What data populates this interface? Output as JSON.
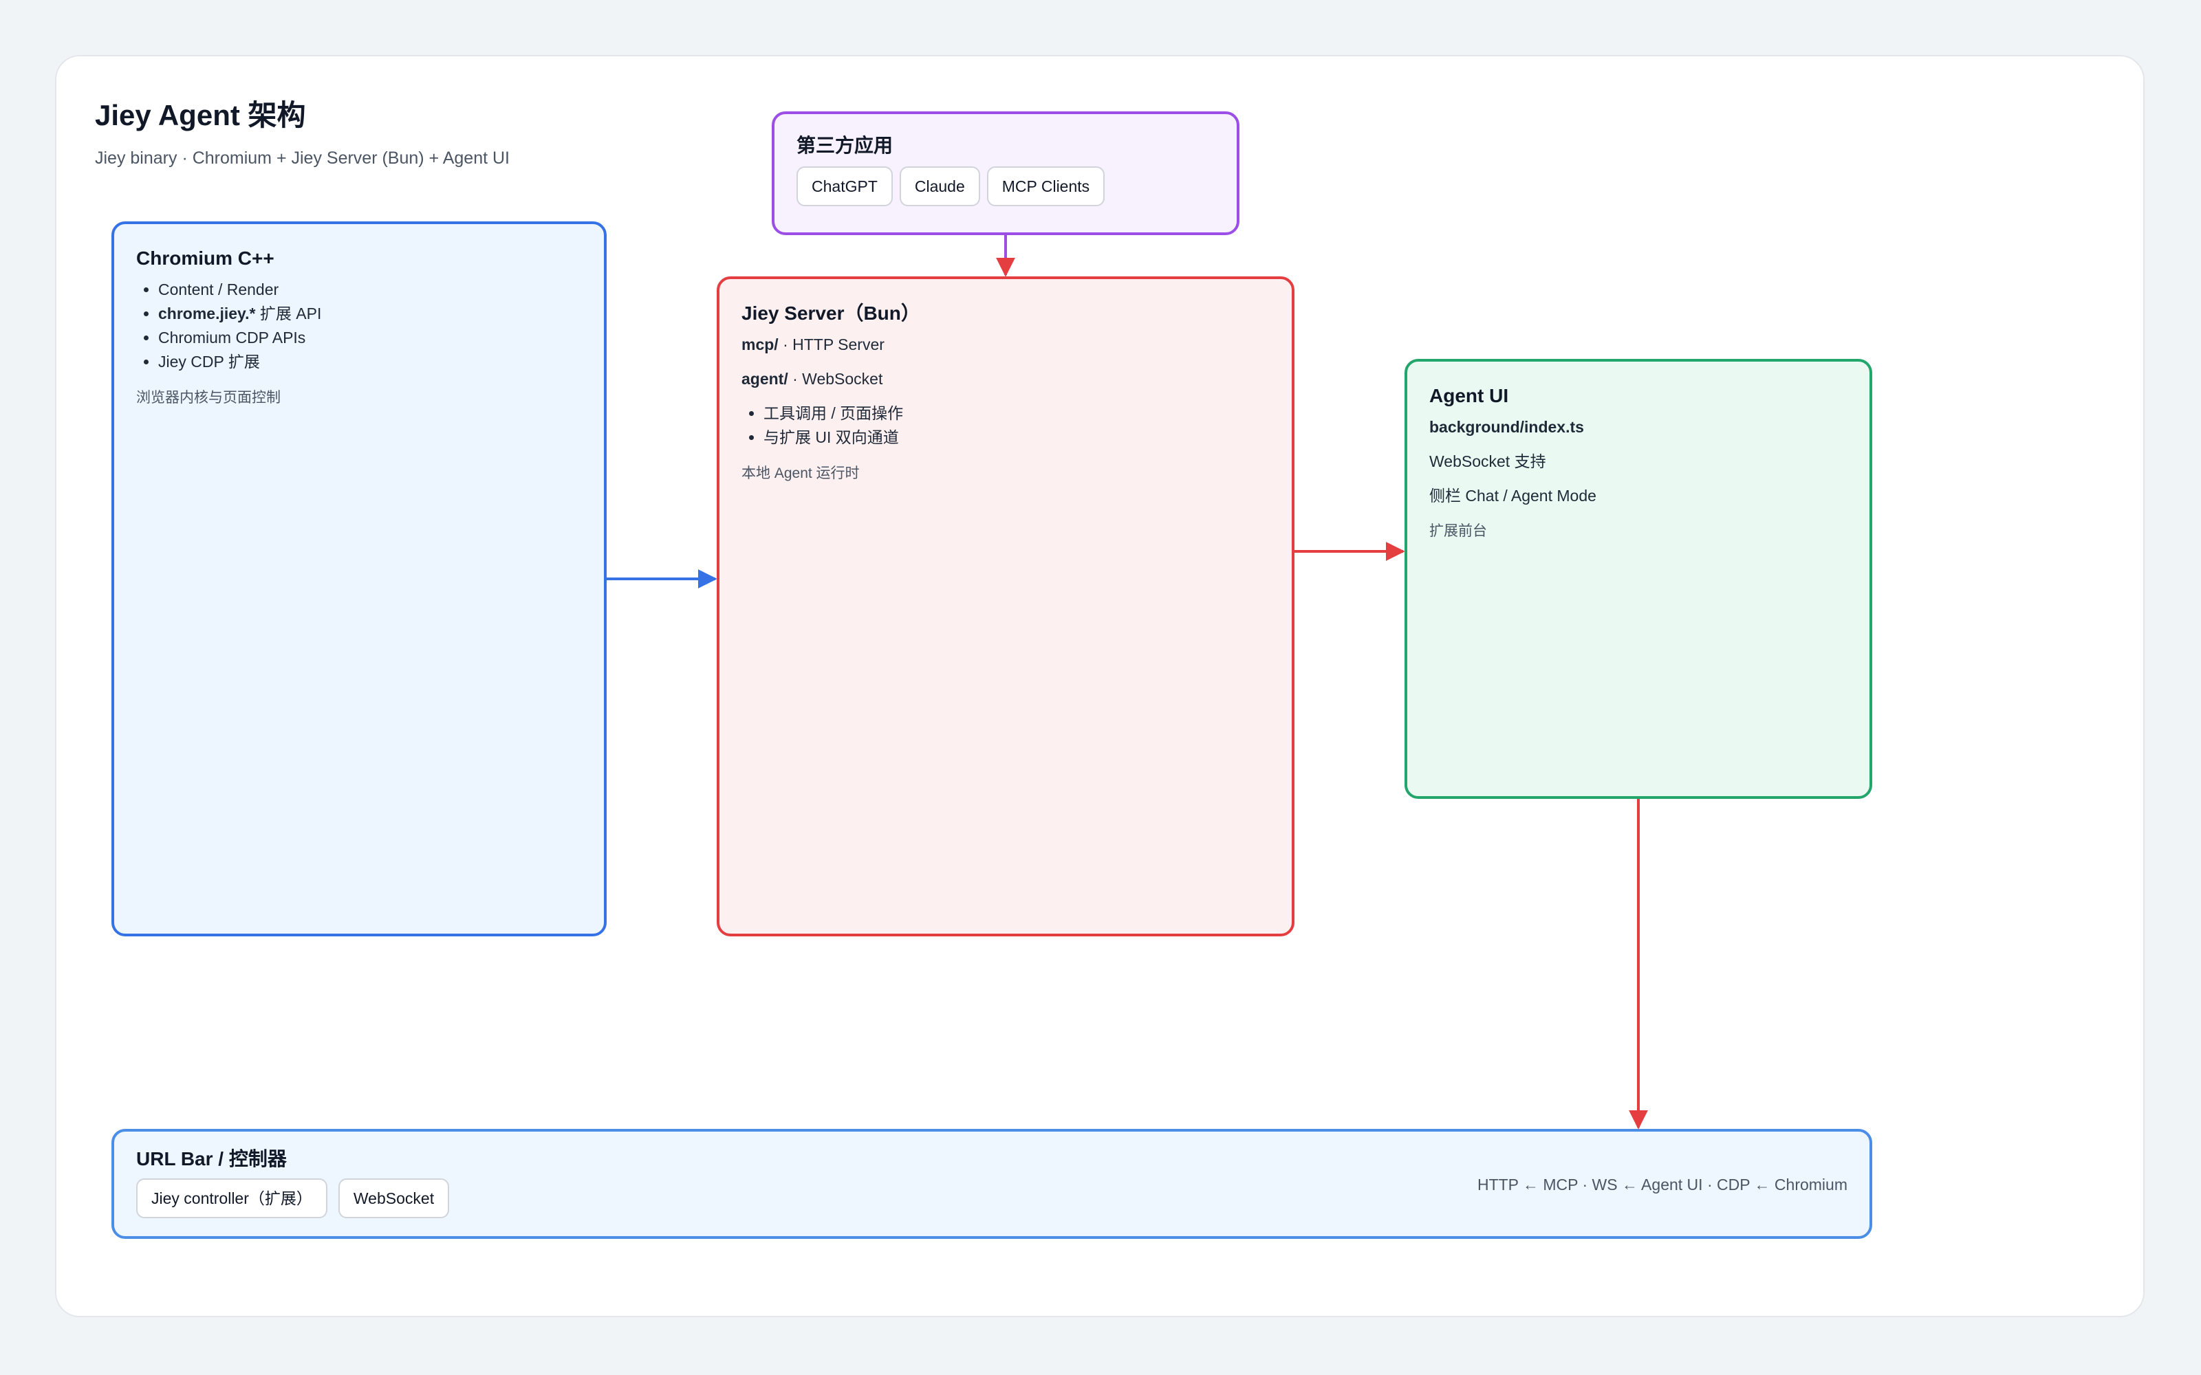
{
  "header": {
    "title": "Jiey Agent 架构",
    "subtitle": "Jiey binary · Chromium + Jiey Server (Bun) + Agent UI"
  },
  "chromium": {
    "title": "Chromium C++",
    "items": [
      {
        "bold": "",
        "text": "Content / Render"
      },
      {
        "bold": "chrome.jiey.*",
        "text": " 扩展 API"
      },
      {
        "bold": "",
        "text": "Chromium CDP APIs"
      },
      {
        "bold": "",
        "text": "Jiey CDP 扩展"
      }
    ],
    "note": "浏览器内核与页面控制"
  },
  "third_party": {
    "title": "第三方应用",
    "chips": [
      "ChatGPT",
      "Claude",
      "MCP Clients"
    ]
  },
  "server": {
    "title": "Jiey Server（Bun）",
    "mcp_label": "mcp/",
    "mcp_text": " · HTTP Server",
    "agent_label": "agent/",
    "agent_text": " · WebSocket",
    "items": [
      "工具调用 / 页面操作",
      "与扩展 UI 双向通道"
    ],
    "note": "本地 Agent 运行时"
  },
  "agent_ui": {
    "title": "Agent UI",
    "file": "background/index.ts",
    "line1": "WebSocket 支持",
    "line2": "侧栏 Chat / Agent Mode",
    "note": "扩展前台"
  },
  "url_bar": {
    "title": "URL Bar / 控制器",
    "chips": [
      "Jiey controller（扩展）",
      "WebSocket"
    ],
    "route_note": "HTTP ← MCP · WS ← Agent UI · CDP ← Chromium"
  },
  "colors": {
    "chromium": "#3472e6",
    "third_party": "#9b4fe6",
    "server": "#e53e40",
    "agent_ui": "#22a66c",
    "url_bar": "#4a8ee8"
  }
}
